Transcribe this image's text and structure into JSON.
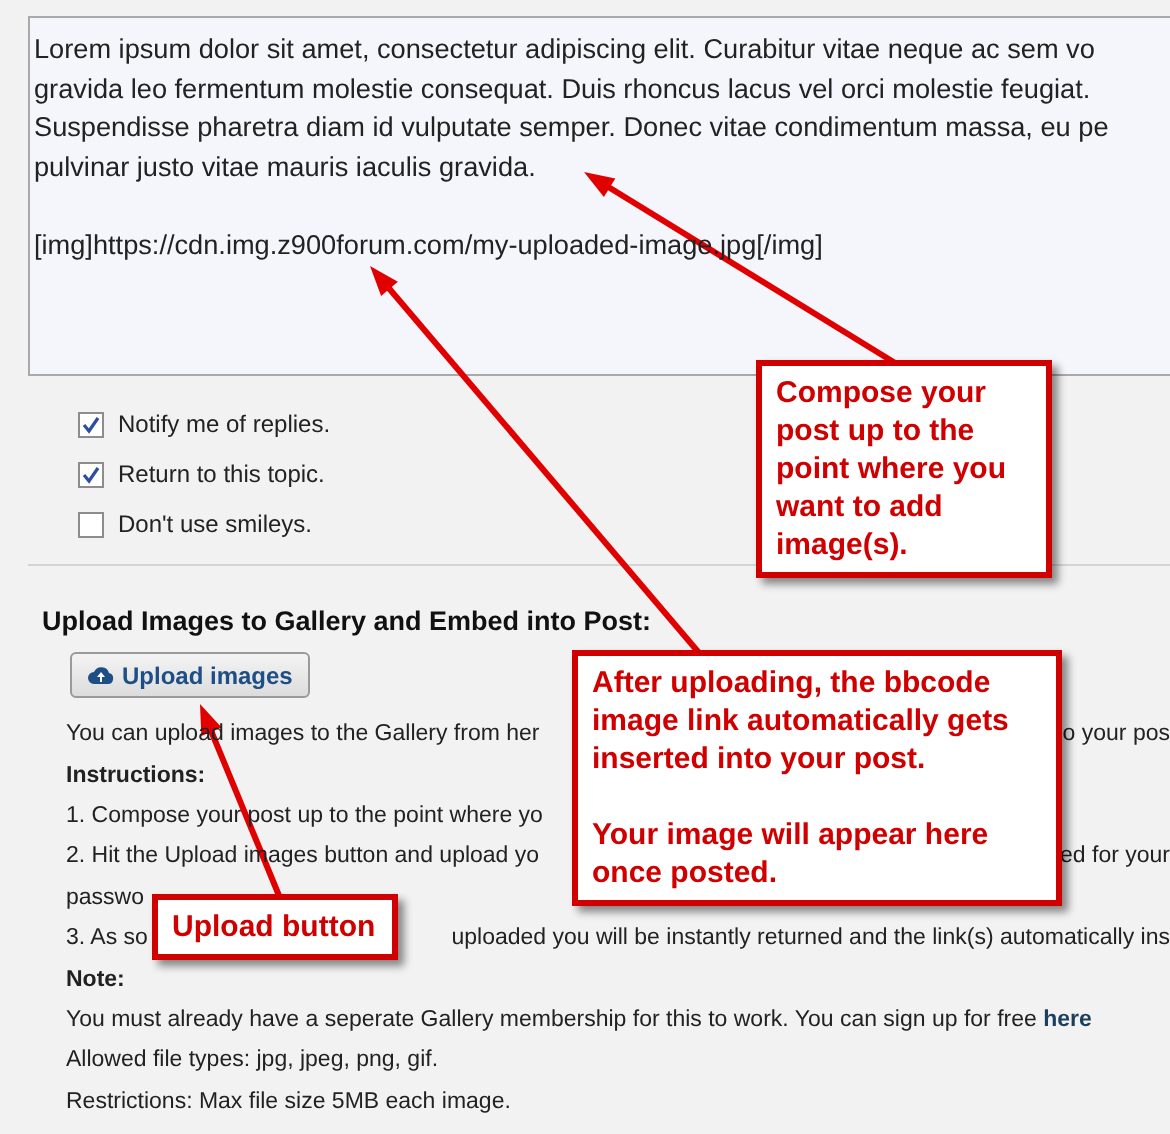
{
  "editor": {
    "paragraphs": [
      [
        "Lorem ipsum dolor sit amet, consectetur adipiscing elit. Curabitur vitae neque ac sem vo",
        "gravida leo fermentum molestie consequat. Duis rhoncus lacus vel orci molestie feugiat.",
        "Suspendisse pharetra diam id vulputate semper. Donec vitae condimentum massa, eu pe",
        "pulvinar justo vitae mauris iaculis gravida."
      ],
      [
        "[img]https://cdn.img.z900forum.com/my-uploaded-image.jpg[/img]"
      ]
    ]
  },
  "options": [
    {
      "label": "Notify me of replies.",
      "checked": true
    },
    {
      "label": "Return to this topic.",
      "checked": true
    },
    {
      "label": "Don't use smileys.",
      "checked": false
    }
  ],
  "upload": {
    "heading": "Upload Images to Gallery and Embed into Post:",
    "button": "Upload images",
    "lines": [
      {
        "kind": "text",
        "segments": [
          "You can upload images to the Gallery from her",
          "o your pos"
        ]
      },
      {
        "kind": "label",
        "segments": [
          "Instructions:"
        ]
      },
      {
        "kind": "text",
        "segments": [
          "1. Compose your post up to the point where yo"
        ]
      },
      {
        "kind": "text",
        "segments": [
          "2. Hit the Upload images button and upload yo",
          "ed for your"
        ]
      },
      {
        "kind": "text",
        "segments": [
          "passwo"
        ]
      },
      {
        "kind": "text",
        "segments": [
          "3. As so",
          "uploaded you will be instantly returned and the link(s) automatically ins"
        ]
      },
      {
        "kind": "label",
        "segments": [
          "Note:"
        ]
      },
      {
        "kind": "text",
        "segments": [
          "You must already have a seperate Gallery membership for this to work. You can sign up for free "
        ],
        "link": "here"
      },
      {
        "kind": "text",
        "segments": [
          "Allowed file types: jpg, jpeg, png, gif."
        ]
      },
      {
        "kind": "text",
        "segments": [
          "Restrictions: Max file size 5MB each image."
        ]
      }
    ]
  },
  "callouts": [
    {
      "paragraphs": [
        "Compose your post up to the point where you want to add image(s)."
      ]
    },
    {
      "paragraphs": [
        "After uploading, the bbcode image link automatically gets inserted into your post.",
        "Your image will appear here once posted."
      ]
    },
    {
      "paragraphs": [
        "Upload button"
      ]
    }
  ]
}
